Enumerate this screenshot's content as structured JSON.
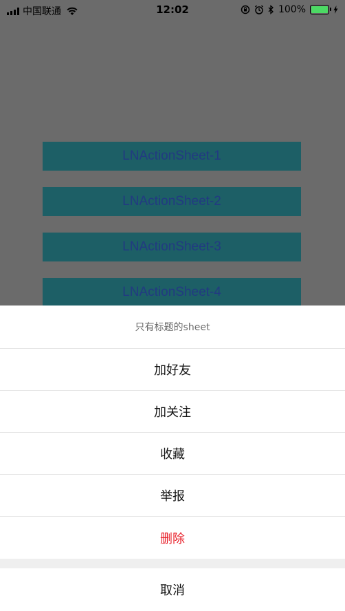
{
  "status_bar": {
    "carrier": "中国联通",
    "time": "12:02",
    "battery": "100%",
    "battery_level": 1.0,
    "icons": [
      "signal-icon",
      "wifi-icon",
      "orientation-lock-icon",
      "alarm-icon",
      "bluetooth-icon",
      "battery-icon",
      "charging-icon"
    ]
  },
  "background_buttons": [
    {
      "label": "LNActionSheet-1"
    },
    {
      "label": "LNActionSheet-2"
    },
    {
      "label": "LNActionSheet-3"
    },
    {
      "label": "LNActionSheet-4"
    }
  ],
  "action_sheet": {
    "title": "只有标题的sheet",
    "items": [
      {
        "label": "加好友"
      },
      {
        "label": "加关注"
      },
      {
        "label": "收藏"
      },
      {
        "label": "举报"
      },
      {
        "label": "删除"
      }
    ],
    "cancel_label": "取消"
  },
  "colors": {
    "overlay_gray": "#6b6b6b",
    "button_teal": "#1d5f66",
    "button_text": "#223a82",
    "destructive_red": "#e8202a",
    "battery_green": "#4cd964"
  }
}
